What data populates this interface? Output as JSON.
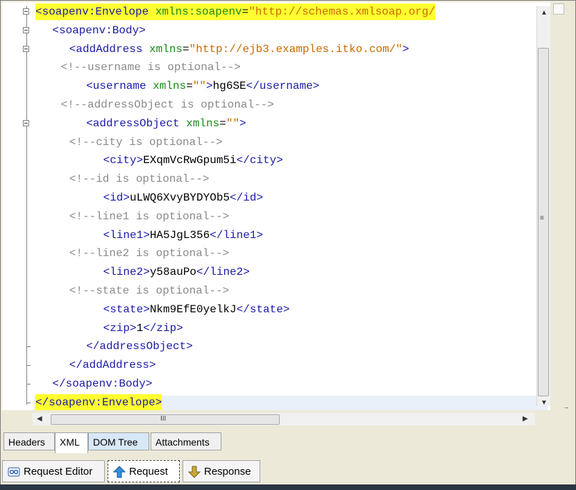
{
  "editor": {
    "lines": [
      {
        "indent": 0,
        "tokens": [
          [
            "tag",
            "<soapenv:Envelope "
          ],
          [
            "attr",
            "xmlns:soapenv"
          ],
          [
            "txt",
            "="
          ],
          [
            "val",
            "\"http://schemas.xmlsoap.org/"
          ]
        ],
        "hl": true
      },
      {
        "indent": 2,
        "tokens": [
          [
            "tag",
            "<soapenv:Body>"
          ]
        ]
      },
      {
        "indent": 4,
        "tokens": [
          [
            "tag",
            "<addAddress "
          ],
          [
            "attr",
            "xmlns"
          ],
          [
            "txt",
            "="
          ],
          [
            "val",
            "\"http://ejb3.examples.itko.com/\""
          ],
          [
            "tag",
            ">"
          ]
        ]
      },
      {
        "indent": 3,
        "tokens": [
          [
            "cmt",
            "<!--username is optional-->"
          ]
        ]
      },
      {
        "indent": 6,
        "tokens": [
          [
            "tag",
            "<username "
          ],
          [
            "attr",
            "xmlns"
          ],
          [
            "txt",
            "="
          ],
          [
            "val",
            "\"\""
          ],
          [
            "tag",
            ">"
          ],
          [
            "txt",
            "hg6SE"
          ],
          [
            "tag",
            "</username>"
          ]
        ]
      },
      {
        "indent": 3,
        "tokens": [
          [
            "cmt",
            "<!--addressObject is optional-->"
          ]
        ]
      },
      {
        "indent": 6,
        "tokens": [
          [
            "tag",
            "<addressObject "
          ],
          [
            "attr",
            "xmlns"
          ],
          [
            "txt",
            "="
          ],
          [
            "val",
            "\"\""
          ],
          [
            "tag",
            ">"
          ]
        ]
      },
      {
        "indent": 4,
        "tokens": [
          [
            "cmt",
            "<!--city is optional-->"
          ]
        ]
      },
      {
        "indent": 8,
        "tokens": [
          [
            "tag",
            "<city>"
          ],
          [
            "txt",
            "EXqmVcRwGpum5i"
          ],
          [
            "tag",
            "</city>"
          ]
        ]
      },
      {
        "indent": 4,
        "tokens": [
          [
            "cmt",
            "<!--id is optional-->"
          ]
        ]
      },
      {
        "indent": 8,
        "tokens": [
          [
            "tag",
            "<id>"
          ],
          [
            "txt",
            "uLWQ6XvyBYDYOb5"
          ],
          [
            "tag",
            "</id>"
          ]
        ]
      },
      {
        "indent": 4,
        "tokens": [
          [
            "cmt",
            "<!--line1 is optional-->"
          ]
        ]
      },
      {
        "indent": 8,
        "tokens": [
          [
            "tag",
            "<line1>"
          ],
          [
            "txt",
            "HA5JgL356"
          ],
          [
            "tag",
            "</line1>"
          ]
        ]
      },
      {
        "indent": 4,
        "tokens": [
          [
            "cmt",
            "<!--line2 is optional-->"
          ]
        ]
      },
      {
        "indent": 8,
        "tokens": [
          [
            "tag",
            "<line2>"
          ],
          [
            "txt",
            "y58auPo"
          ],
          [
            "tag",
            "</line2>"
          ]
        ]
      },
      {
        "indent": 4,
        "tokens": [
          [
            "cmt",
            "<!--state is optional-->"
          ]
        ]
      },
      {
        "indent": 8,
        "tokens": [
          [
            "tag",
            "<state>"
          ],
          [
            "txt",
            "Nkm9EfE0yelkJ"
          ],
          [
            "tag",
            "</state>"
          ]
        ]
      },
      {
        "indent": 8,
        "tokens": [
          [
            "tag",
            "<zip>"
          ],
          [
            "txt",
            "1"
          ],
          [
            "tag",
            "</zip>"
          ]
        ]
      },
      {
        "indent": 6,
        "tokens": [
          [
            "tag",
            "</addressObject>"
          ]
        ]
      },
      {
        "indent": 4,
        "tokens": [
          [
            "tag",
            "</addAddress>"
          ]
        ]
      },
      {
        "indent": 2,
        "tokens": [
          [
            "tag",
            "</soapenv:Body>"
          ]
        ]
      },
      {
        "indent": 0,
        "tokens": [
          [
            "tag",
            "</soapenv:Envelope>"
          ]
        ],
        "hl": true
      }
    ],
    "hscroll_grip": "III",
    "vscroll_grip": "≡"
  },
  "view_tabs": [
    {
      "label": "Headers"
    },
    {
      "label": "XML",
      "active": true
    },
    {
      "label": "DOM Tree"
    },
    {
      "label": "Attachments"
    }
  ],
  "bottom_tabs": [
    {
      "label": "Request Editor",
      "icon": "request-editor-icon"
    },
    {
      "label": "Request",
      "icon": "up-arrow-icon",
      "selected": true
    },
    {
      "label": "Response",
      "icon": "down-arrow-icon"
    }
  ],
  "colors": {
    "highlight": "#ffff30",
    "tag": "#1a1aa8",
    "attr": "#1a8a1a",
    "value": "#c86a00",
    "comment": "#8a8a8a"
  }
}
